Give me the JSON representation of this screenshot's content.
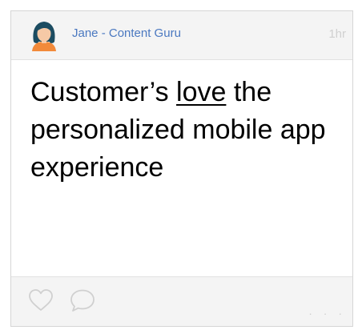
{
  "post": {
    "author": "Jane - Content Guru",
    "time": "1hr",
    "text_before": "Customer’s ",
    "text_emphasis": "love",
    "text_after": " the personalized mobile app experience"
  },
  "actions": {
    "like_icon": "heart-icon",
    "comment_icon": "comment-icon",
    "more_label": "· · ·"
  },
  "colors": {
    "author_link": "#4a78c0",
    "icon_stroke": "#d0d0d0",
    "header_bg": "#f4f4f4",
    "avatar_hair": "#1c4c61",
    "avatar_shirt": "#f28a3a"
  }
}
